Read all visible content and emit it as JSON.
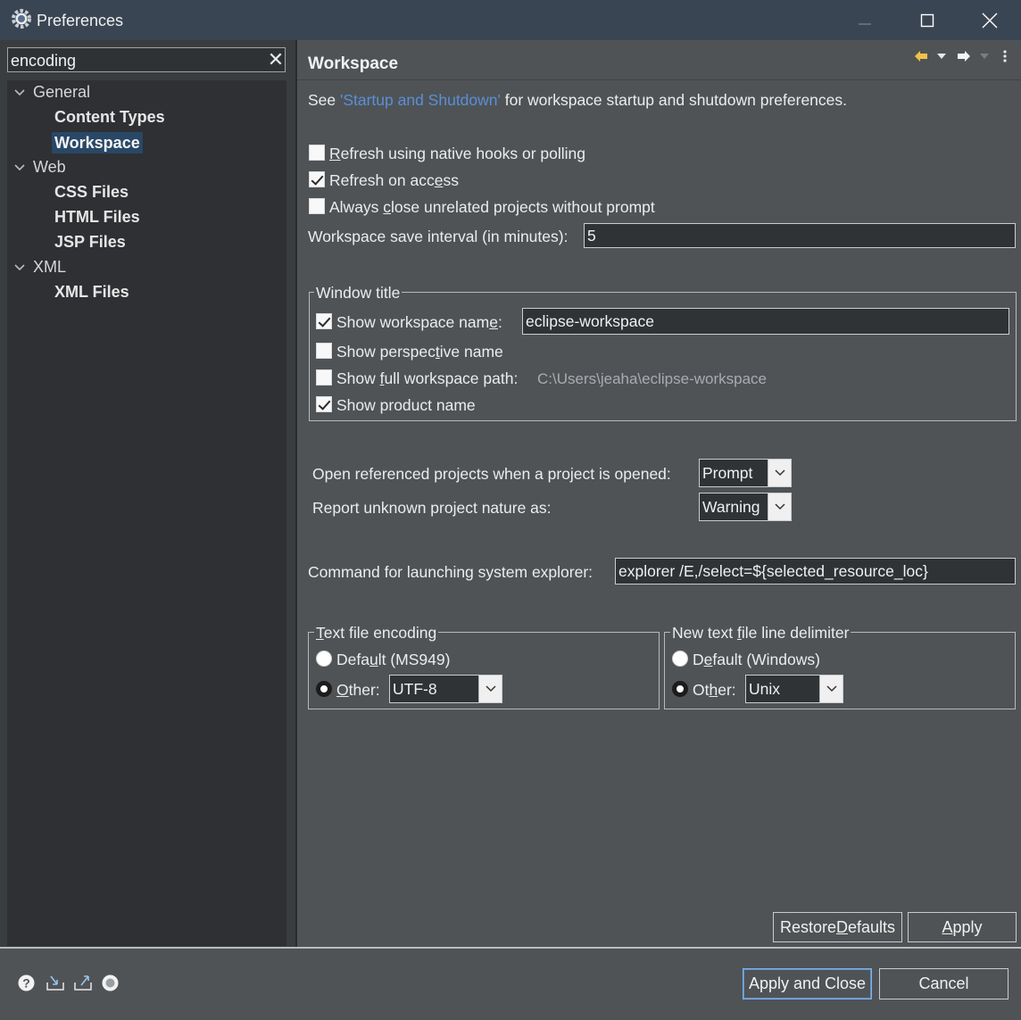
{
  "window": {
    "title": "Preferences"
  },
  "filter": {
    "value": "encoding"
  },
  "tree": [
    {
      "label": "General",
      "children": [
        "Content Types",
        "Workspace"
      ]
    },
    {
      "label": "Web",
      "children": [
        "CSS Files",
        "HTML Files",
        "JSP Files"
      ]
    },
    {
      "label": "XML",
      "children": [
        "XML Files"
      ]
    }
  ],
  "page": {
    "title": "Workspace",
    "intro_prefix": "See ",
    "intro_link": "'Startup and Shutdown'",
    "intro_suffix": " for workspace startup and shutdown preferences.",
    "refresh_native": {
      "pre": "",
      "u": "R",
      "post": "efresh using native hooks or polling",
      "checked": false
    },
    "refresh_access": {
      "pre": "Refresh on acc",
      "u": "e",
      "post": "ss",
      "checked": true
    },
    "close_unrelated": {
      "pre": "Always ",
      "u": "c",
      "post": "lose unrelated projects without prompt",
      "checked": false
    },
    "save_interval_label": "Workspace save interval (in minutes):",
    "save_interval_value": "5",
    "window_title": {
      "legend": "Window title",
      "show_ws_name": {
        "pre": "Show workspace nam",
        "u": "e",
        "post": ":",
        "checked": true
      },
      "ws_name_value": "eclipse-workspace",
      "show_perspective": {
        "pre": "Show perspec",
        "u": "t",
        "post": "ive name",
        "checked": false
      },
      "show_full_path": {
        "pre": "Show ",
        "u": "f",
        "post": "ull workspace path:",
        "checked": false
      },
      "full_path_value": "C:\\Users\\jeaha\\eclipse-workspace",
      "show_product": {
        "label": "Show product name",
        "checked": true
      }
    },
    "open_ref_label": "Open referenced projects when a project is opened:",
    "open_ref_value": "Prompt",
    "unknown_nature_label": "Report unknown project nature as:",
    "unknown_nature_value": "Warning",
    "explorer_label": "Command for launching system explorer:",
    "explorer_value": "explorer /E,/select=${selected_resource_loc}",
    "encoding": {
      "legend_u": "T",
      "legend_post": "ext file encoding",
      "default": {
        "pre": "Defa",
        "u": "u",
        "post": "lt (MS949)",
        "selected": false
      },
      "other": {
        "u": "O",
        "post": "ther:",
        "selected": true
      },
      "other_value": "UTF-8"
    },
    "delimiter": {
      "legend_pre": "New text ",
      "legend_u": "f",
      "legend_post": "ile line delimiter",
      "default": {
        "pre": "D",
        "u": "e",
        "post": "fault (Windows)",
        "selected": false
      },
      "other": {
        "pre": "Ot",
        "u": "h",
        "post": "er:",
        "selected": true
      },
      "other_value": "Unix"
    },
    "restore_defaults": {
      "pre": "Restore ",
      "u": "D",
      "post": "efaults"
    },
    "apply": {
      "u": "A",
      "post": "pply"
    }
  },
  "footer": {
    "apply_close": "Apply and Close",
    "cancel": "Cancel"
  },
  "colors": {
    "titlebar": "#3a4553",
    "background": "#4f5356",
    "tree_background": "#2e3033",
    "selection": "#294866",
    "link": "#5b8fd6"
  }
}
